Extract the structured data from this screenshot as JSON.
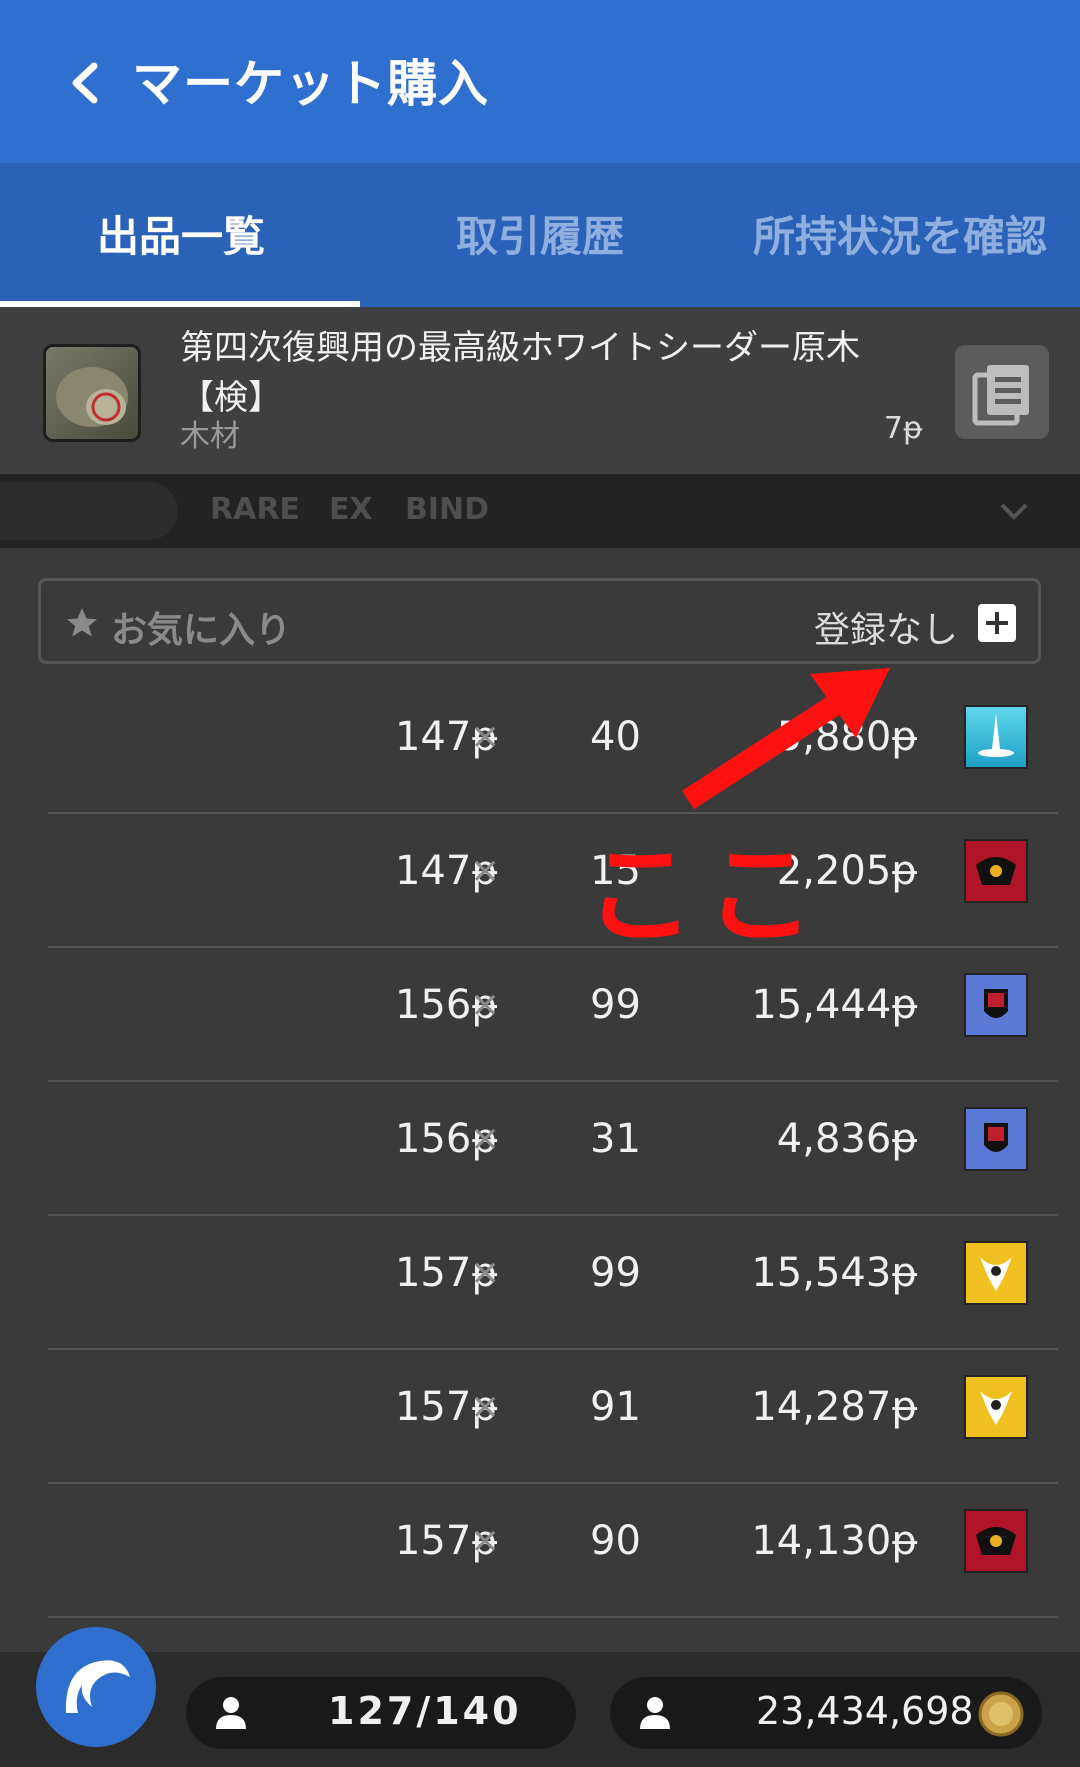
{
  "header": {
    "title": "マーケット購入"
  },
  "tabs": [
    {
      "label": "出品一覧",
      "active": true
    },
    {
      "label": "取引履歴",
      "active": false
    },
    {
      "label": "所持状況を確認",
      "active": false
    }
  ],
  "item": {
    "name": "第四次復興用の最高級ホワイトシーダー原木【検】",
    "category": "木材",
    "price": "7ᵽ"
  },
  "filters": [
    "RARE",
    "EX",
    "BIND"
  ],
  "favorite": {
    "label": "お気に入り",
    "status": "登録なし"
  },
  "listings": [
    {
      "unit_price": "147ᵽ",
      "qty": "40",
      "total": "5,880ᵽ",
      "crest": "crystal"
    },
    {
      "unit_price": "147ᵽ",
      "qty": "15",
      "total": "2,205ᵽ",
      "crest": "red"
    },
    {
      "unit_price": "156ᵽ",
      "qty": "99",
      "total": "15,444ᵽ",
      "crest": "blue"
    },
    {
      "unit_price": "156ᵽ",
      "qty": "31",
      "total": "4,836ᵽ",
      "crest": "blue"
    },
    {
      "unit_price": "157ᵽ",
      "qty": "99",
      "total": "15,543ᵽ",
      "crest": "yellow"
    },
    {
      "unit_price": "157ᵽ",
      "qty": "91",
      "total": "14,287ᵽ",
      "crest": "yellow"
    },
    {
      "unit_price": "157ᵽ",
      "qty": "90",
      "total": "14,130ᵽ",
      "crest": "red"
    }
  ],
  "multiply_sign": "×",
  "annotation": {
    "text": "ここ",
    "color": "#ff1111"
  },
  "footer": {
    "retainers": "127/140",
    "gil": "23,434,698"
  },
  "colors": {
    "header": "#2e6fd0",
    "tabs": "#2a62b8",
    "background": "#3a3a3a"
  }
}
